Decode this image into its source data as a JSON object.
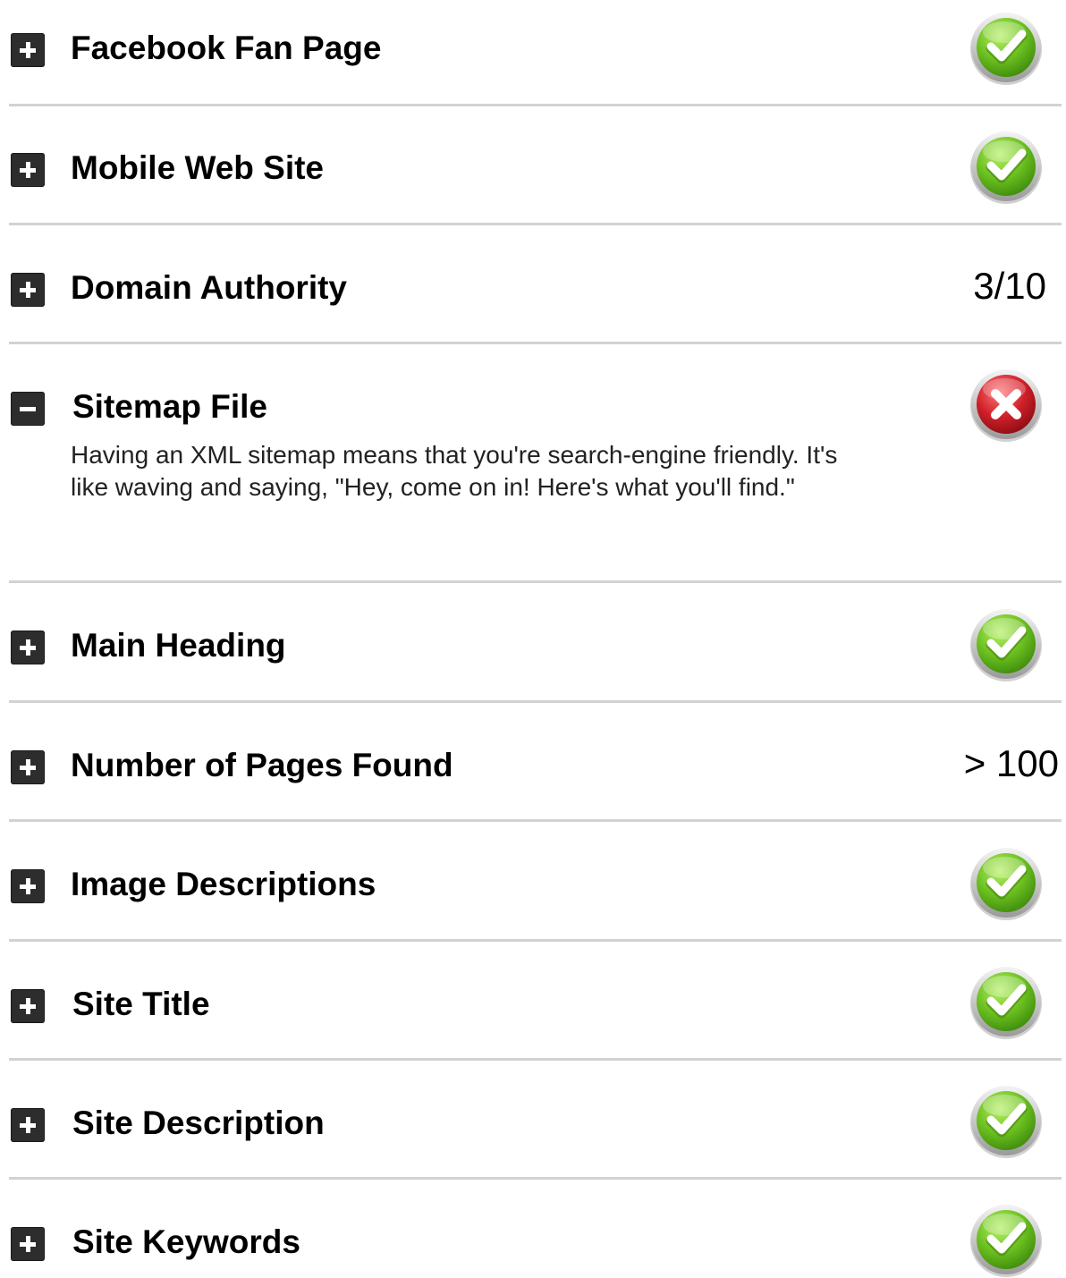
{
  "colors": {
    "pass_green": "#6cc020",
    "fail_red": "#d0202a",
    "divider": "#d2d2d2",
    "toggle_bg": "#2d2d2d"
  },
  "rows": [
    {
      "title": "Facebook Fan Page",
      "status": "pass",
      "expanded": false,
      "toggle_icon": "plus-icon"
    },
    {
      "title": "Mobile Web Site",
      "status": "pass",
      "expanded": false,
      "toggle_icon": "plus-icon"
    },
    {
      "title": "Domain Authority",
      "value": "3/10",
      "expanded": false,
      "toggle_icon": "plus-icon"
    },
    {
      "title": "Sitemap File",
      "status": "fail",
      "expanded": true,
      "toggle_icon": "minus-icon",
      "description": "Having an XML sitemap means that you're search-engine friendly. It's like waving and saying, \"Hey, come on in! Here's what you'll find.\""
    },
    {
      "title": "Main Heading",
      "status": "pass",
      "expanded": false,
      "toggle_icon": "plus-icon"
    },
    {
      "title": "Number of Pages Found",
      "value": "> 100",
      "expanded": false,
      "toggle_icon": "plus-icon"
    },
    {
      "title": "Image Descriptions",
      "status": "pass",
      "expanded": false,
      "toggle_icon": "plus-icon"
    },
    {
      "title": "Site Title",
      "status": "pass",
      "expanded": false,
      "toggle_icon": "plus-icon"
    },
    {
      "title": "Site Description",
      "status": "pass",
      "expanded": false,
      "toggle_icon": "plus-icon"
    },
    {
      "title": "Site Keywords",
      "status": "pass",
      "expanded": false,
      "toggle_icon": "plus-icon"
    }
  ]
}
